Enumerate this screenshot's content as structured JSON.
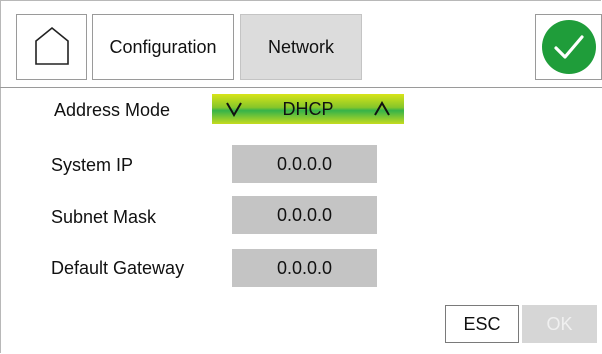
{
  "header": {
    "home_icon": "home-icon",
    "configuration_label": "Configuration",
    "network_label": "Network",
    "confirm_icon": "checkmark-icon",
    "confirm_color": "#1f9d3a",
    "active_tab_color": "#dcdcdc"
  },
  "form": {
    "address_mode": {
      "label": "Address Mode",
      "value": "DHCP",
      "prev_icon": "chevron-down-icon",
      "next_icon": "chevron-up-icon"
    },
    "system_ip": {
      "label": "System IP",
      "value": "0.0.0.0"
    },
    "subnet_mask": {
      "label": "Subnet Mask",
      "value": "0.0.0.0"
    },
    "default_gateway": {
      "label": "Default Gateway",
      "value": "0.0.0.0"
    }
  },
  "footer": {
    "esc_label": "ESC",
    "ok_label": "OK"
  }
}
